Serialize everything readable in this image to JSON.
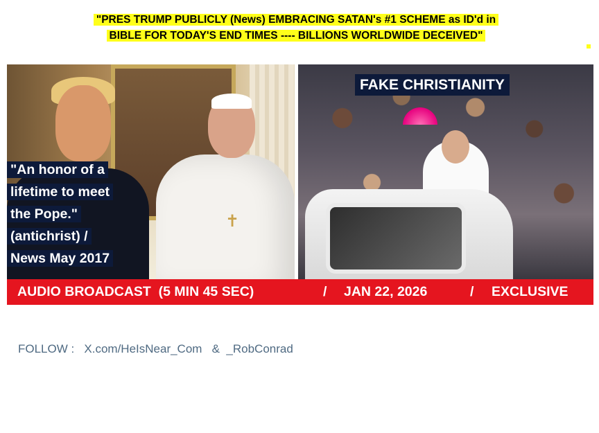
{
  "headline": {
    "line1": "\"PRES TRUMP PUBLICLY (News)  EMBRACING SATAN's #1 SCHEME as ID'd in",
    "line2": "BIBLE FOR TODAY'S END TIMES  ----  BILLIONS  WORLDWIDE  DECEIVED\""
  },
  "left_photo": {
    "quote_lines": [
      "\"An honor of a",
      "lifetime to meet",
      "the Pope.\"",
      "(antichrist) /",
      "News May 2017"
    ]
  },
  "right_photo": {
    "label": "FAKE CHRISTIANITY"
  },
  "banner": {
    "part1": "AUDIO BROADCAST  (5 MIN 45 SEC)",
    "sep1": "/",
    "part2": "JAN 22, 2026",
    "sep2": "/",
    "part3": "EXCLUSIVE"
  },
  "footer": {
    "follow_text": "FOLLOW :   X.com/HeIsNear_Com   &  _RobConrad"
  },
  "colors": {
    "highlight": "#ffff1a",
    "banner": "#e5151f",
    "label_bg": "#0d1a3a",
    "footer_text": "#4f6a82"
  }
}
